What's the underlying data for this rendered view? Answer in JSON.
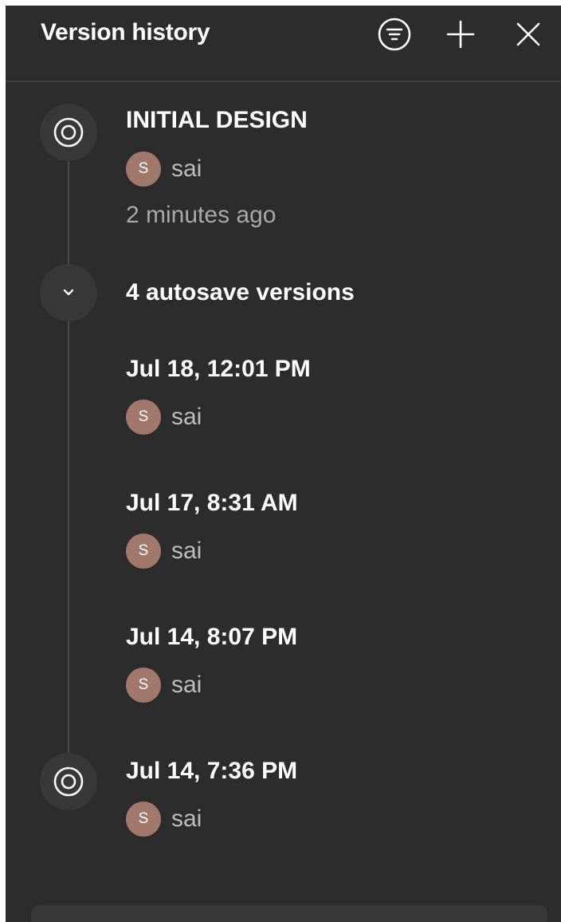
{
  "header": {
    "title": "Version history"
  },
  "versions": [
    {
      "title": "INITIAL DESIGN",
      "author_initial": "S",
      "author": "sai",
      "time": "2 minutes ago"
    }
  ],
  "autosave": {
    "label": "4 autosave versions",
    "items": [
      {
        "title": "Jul 18, 12:01 PM",
        "author_initial": "S",
        "author": "sai"
      },
      {
        "title": "Jul 17, 8:31 AM",
        "author_initial": "S",
        "author": "sai"
      },
      {
        "title": "Jul 14, 8:07 PM",
        "author_initial": "S",
        "author": "sai"
      },
      {
        "title": "Jul 14, 7:36 PM",
        "author_initial": "S",
        "author": "sai"
      }
    ]
  },
  "colors": {
    "panel_bg": "#2c2c2c",
    "node_bg": "#383838",
    "avatar_bg": "#a1786b",
    "text_primary": "#ffffff",
    "text_secondary": "#a8a8a8"
  },
  "icons": {
    "filter": "filter-icon",
    "add": "plus-icon",
    "close": "close-icon",
    "version_node": "target-icon",
    "expand": "chevron-down-icon"
  }
}
